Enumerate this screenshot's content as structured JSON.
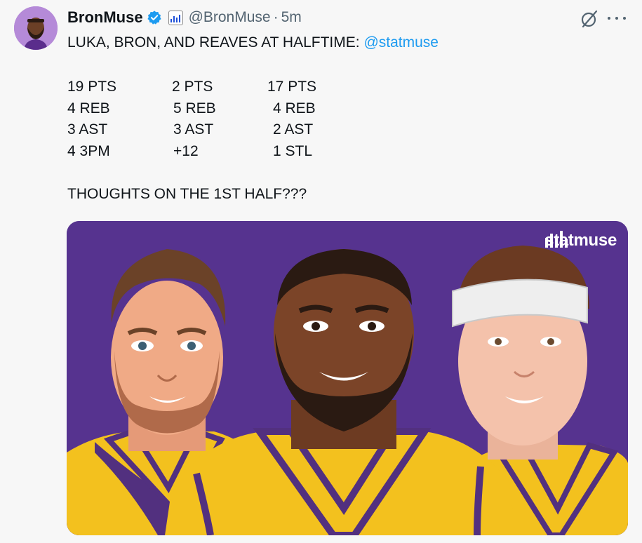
{
  "tweet": {
    "display_name": "BronMuse",
    "handle": "@BronMuse",
    "separator": "·",
    "time": "5m",
    "headline": "LUKA, BRON, AND REAVES AT HALFTIME: ",
    "mention": "@statmuse",
    "question": "THOUGHTS ON THE 1ST HALF???"
  },
  "stats": {
    "luka": [
      "19 PTS",
      "4 REB",
      "3 AST",
      "4 3PM"
    ],
    "bron": [
      "2 PTS",
      "5 REB",
      "3 AST",
      "+12"
    ],
    "reaves": [
      "17 PTS",
      "4 REB",
      "2 AST",
      "1 STL"
    ]
  },
  "media": {
    "brand": "statmuse",
    "players": [
      "luka",
      "bron",
      "reaves"
    ]
  },
  "colors": {
    "purple": "#56338f",
    "gold": "#f3c11e",
    "link": "#1d9bf0",
    "muted": "#536471"
  },
  "icons": [
    "verified-icon",
    "affiliate-badge-icon",
    "grok-icon",
    "more-icon",
    "statmuse-logo-icon"
  ]
}
